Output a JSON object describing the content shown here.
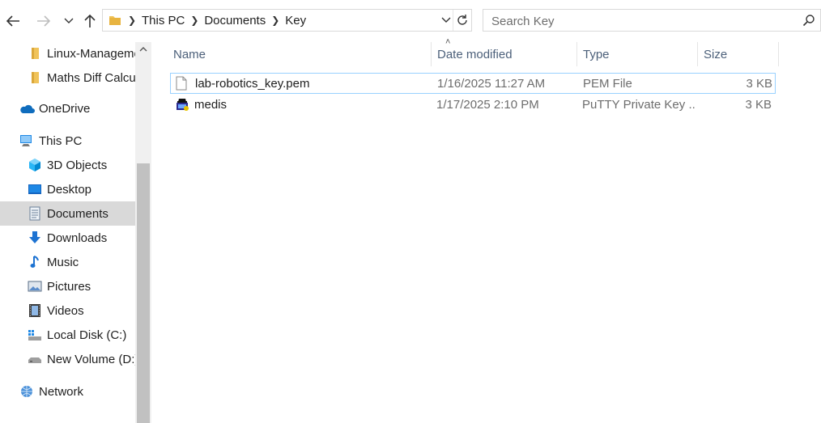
{
  "address_bar": {
    "breadcrumbs": [
      "This PC",
      "Documents",
      "Key"
    ]
  },
  "search": {
    "placeholder": "Search Key"
  },
  "sidebar": {
    "items": [
      {
        "label": "Linux-Manageme",
        "icon": "folder-icon"
      },
      {
        "label": "Maths Diff Calcu",
        "icon": "folder-icon"
      },
      {
        "label": "OneDrive",
        "icon": "cloud-icon"
      },
      {
        "label": "This PC",
        "icon": "computer-icon"
      },
      {
        "label": "3D Objects",
        "icon": "cube-icon"
      },
      {
        "label": "Desktop",
        "icon": "desktop-icon"
      },
      {
        "label": "Documents",
        "icon": "document-icon",
        "selected": true
      },
      {
        "label": "Downloads",
        "icon": "download-icon"
      },
      {
        "label": "Music",
        "icon": "music-note-icon"
      },
      {
        "label": "Pictures",
        "icon": "picture-icon"
      },
      {
        "label": "Videos",
        "icon": "film-icon"
      },
      {
        "label": "Local Disk (C:)",
        "icon": "drive-icon"
      },
      {
        "label": "New Volume (D:)",
        "icon": "drive-icon"
      },
      {
        "label": "Network",
        "icon": "network-icon"
      }
    ]
  },
  "file_list": {
    "columns": [
      "Name",
      "Date modified",
      "Type",
      "Size"
    ],
    "rows": [
      {
        "name": "lab-robotics_key.pem",
        "date": "1/16/2025 11:27 AM",
        "type": "PEM File",
        "size": "3 KB",
        "icon": "file-icon"
      },
      {
        "name": "medis",
        "date": "1/17/2025 2:10 PM",
        "type": "PuTTY Private Key ...",
        "size": "3 KB",
        "icon": "putty-key-icon"
      }
    ]
  },
  "colors": {
    "accent": "#0078d7",
    "folder": "#f0c35a",
    "selected_bg": "#d9d9d9",
    "focus_border": "#99d1ff",
    "header_text": "#4c607a"
  }
}
